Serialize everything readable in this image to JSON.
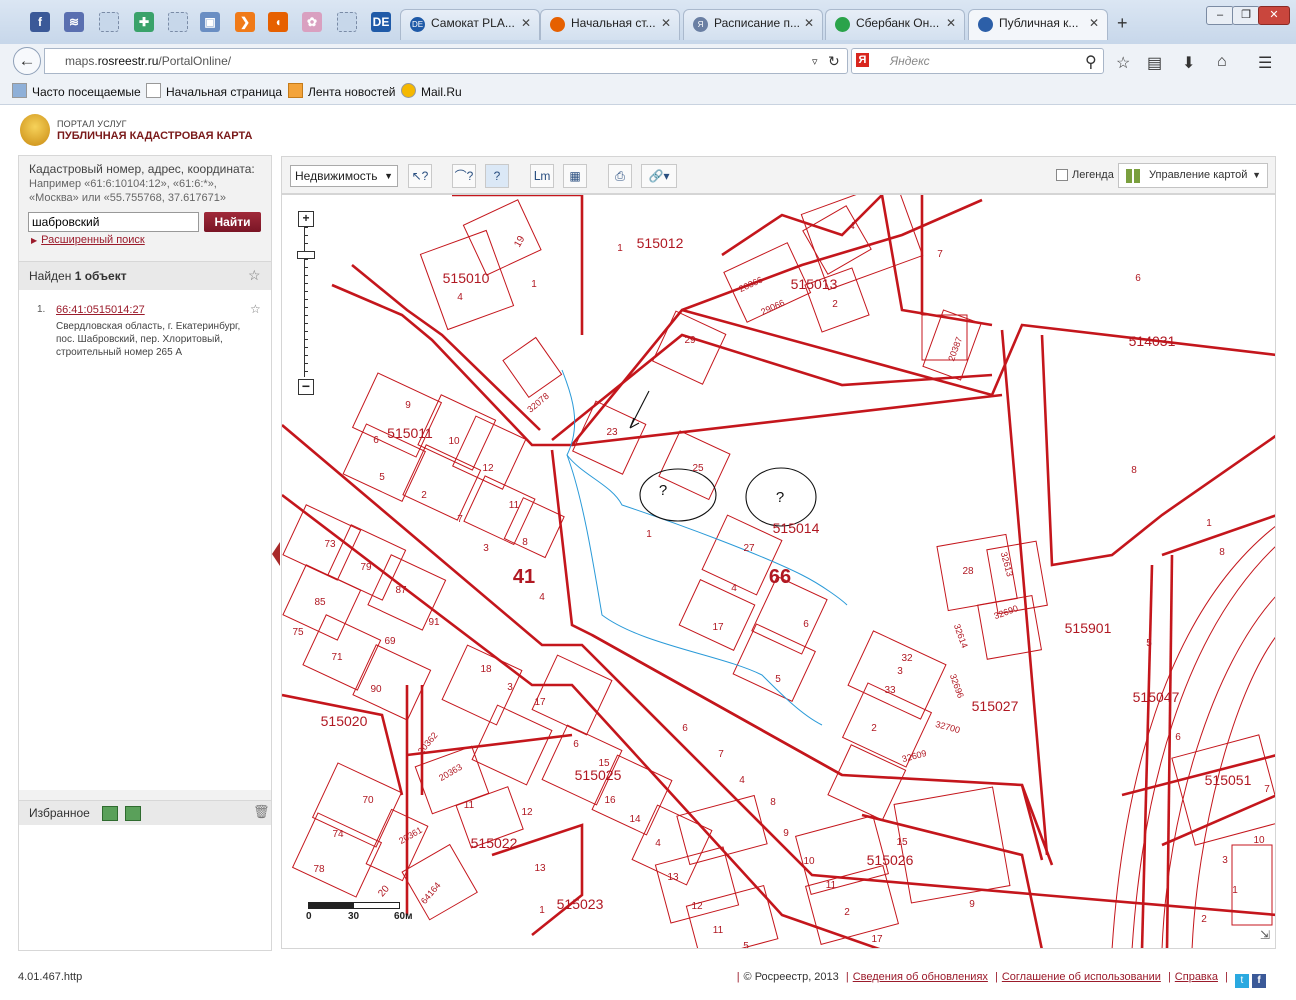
{
  "browser": {
    "pinned_tabs": [
      {
        "icon": "facebook-icon",
        "glyph": "f",
        "color": "#3b5998"
      },
      {
        "icon": "wifi-icon",
        "glyph": "≋",
        "color": "#5a6fb0"
      },
      {
        "icon": "blank-page-icon",
        "glyph": "",
        "color": "#c7d7ea"
      },
      {
        "icon": "plus-green-icon",
        "glyph": "✚",
        "color": "#3aa26a"
      },
      {
        "icon": "blank-page-icon",
        "glyph": "",
        "color": "#c7d7ea"
      },
      {
        "icon": "app-icon",
        "glyph": "▣",
        "color": "#6a8ec3"
      },
      {
        "icon": "play-orange-icon",
        "glyph": "❯",
        "color": "#f07a18"
      },
      {
        "icon": "firefox-icon",
        "glyph": "◖",
        "color": "#e66000"
      },
      {
        "icon": "puzzle-icon",
        "glyph": "✿",
        "color": "#d9a0c0"
      },
      {
        "icon": "blank-page-icon",
        "glyph": "",
        "color": "#c7d7ea"
      },
      {
        "icon": "de-icon",
        "glyph": "DE",
        "color": "#1f5aa8"
      }
    ],
    "tabs": [
      {
        "label": "Самокат PLA...",
        "icon_color": "#1f5aa8",
        "icon_text": "DE"
      },
      {
        "label": "Начальная ст...",
        "icon_color": "#e66000",
        "icon_text": ""
      },
      {
        "label": "Расписание п...",
        "icon_color": "#6a7fa3",
        "icon_text": "Я"
      },
      {
        "label": "Сбербанк Он...",
        "icon_color": "#2aa34a",
        "icon_text": ""
      },
      {
        "label": "Публичная к...",
        "icon_color": "#2c5fa8",
        "icon_text": ""
      }
    ],
    "url_prefix": "maps.",
    "url_domain": "rosreestr.ru",
    "url_path": "/PortalOnline/",
    "search_placeholder": "Яндекс",
    "bookmarks": [
      "Часто посещаемые",
      "Начальная страница",
      "Лента новостей",
      "Mail.Ru"
    ]
  },
  "portal": {
    "subtitle": "ПОРТАЛ УСЛУГ",
    "title": "ПУБЛИЧНАЯ КАДАСТРОВАЯ КАРТА"
  },
  "search": {
    "hint": "Кадастровый номер, адрес, координата:",
    "example_line1": "Например «61:6:10104:12», «61:6:*»,",
    "example_line2": "«Москва» или «55.755768, 37.617671»",
    "value": "шабровский",
    "button": "Найти",
    "advanced": "Расширенный поиск"
  },
  "results": {
    "found_prefix": "Найден",
    "found_count": "1 объект",
    "items": [
      {
        "num": "1.",
        "cadastral": "66:41:0515014:27",
        "address": "Свердловская область, г. Екатеринбург, пос. Шабровский, пер. Хлоритовый, строительный номер 265 А"
      }
    ]
  },
  "favorites": {
    "title": "Избранное"
  },
  "toolbar": {
    "layer": "Недвижимость",
    "legend": "Легенда",
    "map_control": "Управление картой"
  },
  "map": {
    "block_labels": [
      {
        "text": "515012"
      },
      {
        "text": "515010"
      },
      {
        "text": "515013"
      },
      {
        "text": "514031"
      },
      {
        "text": "515011"
      },
      {
        "text": "515014"
      },
      {
        "text": "515901"
      },
      {
        "text": "515020"
      },
      {
        "text": "515025"
      },
      {
        "text": "515027"
      },
      {
        "text": "515047"
      },
      {
        "text": "515022"
      },
      {
        "text": "515026"
      },
      {
        "text": "515051"
      },
      {
        "text": "515023"
      }
    ],
    "big_labels": [
      "41",
      "66"
    ],
    "parcel_labels": [
      "1",
      "19",
      "4",
      "1",
      "20366",
      "29066",
      "2",
      "4",
      "7",
      "6",
      "29",
      "20387",
      "32078",
      "23",
      "25",
      "8",
      "9",
      "6",
      "10",
      "5",
      "12",
      "2",
      "7",
      "11",
      "3",
      "8",
      "4",
      "1",
      "27",
      "4",
      "17",
      "6",
      "5",
      "28",
      "32613",
      "32690",
      "32614",
      "32",
      "3",
      "33",
      "32696",
      "2",
      "32700",
      "32609",
      "73",
      "79",
      "85",
      "87",
      "75",
      "91",
      "69",
      "71",
      "90",
      "18",
      "3",
      "17",
      "6",
      "15",
      "16",
      "14",
      "4",
      "20362",
      "20363",
      "11",
      "12",
      "13",
      "70",
      "74",
      "20361",
      "78",
      "20",
      "64164",
      "1",
      "13",
      "12",
      "11",
      "5",
      "6",
      "7",
      "4",
      "8",
      "9",
      "10",
      "11",
      "2",
      "17",
      "15",
      "9",
      "3",
      "8",
      "1",
      "5",
      "6",
      "7",
      "10",
      "1",
      "2"
    ],
    "scale": {
      "labels": [
        "0",
        "30",
        "60м"
      ]
    },
    "annotation_marks": [
      "?",
      "?"
    ]
  },
  "footer": {
    "version": "4.01.467.http",
    "copyright": "© Росреестр, 2013",
    "links": [
      "Сведения об обновлениях",
      "Соглашение об использовании",
      "Справка"
    ]
  }
}
